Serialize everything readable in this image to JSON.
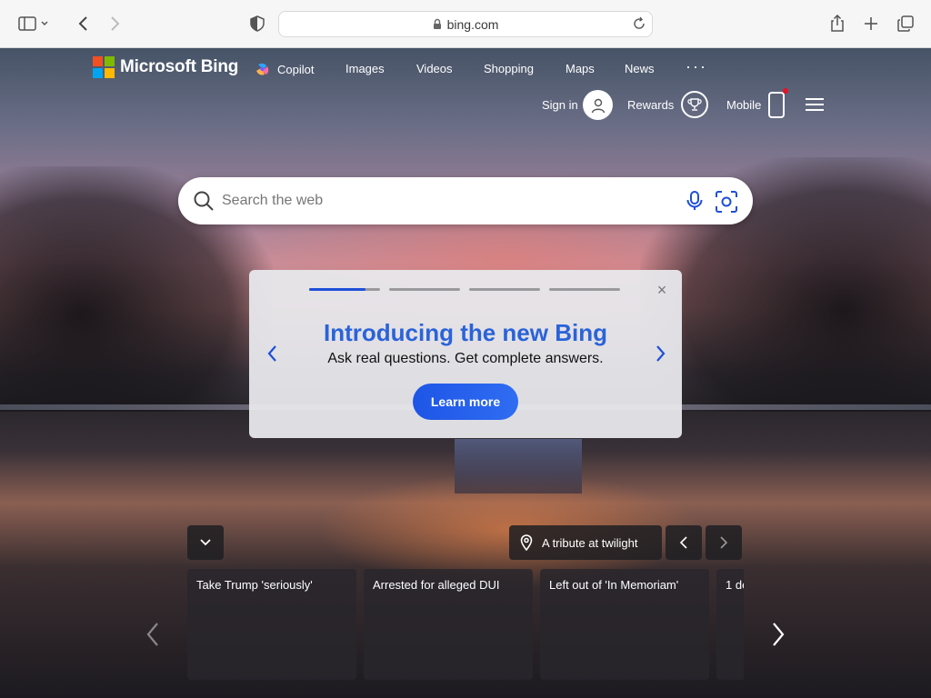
{
  "browser": {
    "url": "bing.com"
  },
  "header": {
    "brand": "Microsoft Bing",
    "nav": [
      "Copilot",
      "Images",
      "Videos",
      "Shopping",
      "Maps",
      "News"
    ],
    "more": "···",
    "sign_in": "Sign in",
    "rewards": "Rewards",
    "mobile": "Mobile"
  },
  "search": {
    "placeholder": "Search the web"
  },
  "promo": {
    "title": "Introducing the new Bing",
    "subtitle": "Ask real questions. Get complete answers.",
    "button": "Learn more",
    "close": "×"
  },
  "image_caption": "A tribute at twilight",
  "news": [
    "Take Trump 'seriously'",
    "Arrested for alleged DUI",
    "Left out of 'In Memoriam'",
    "1 de"
  ],
  "colors": {
    "accent": "#2a63d8",
    "button": "#1e55e6",
    "notification": "#e81123"
  }
}
